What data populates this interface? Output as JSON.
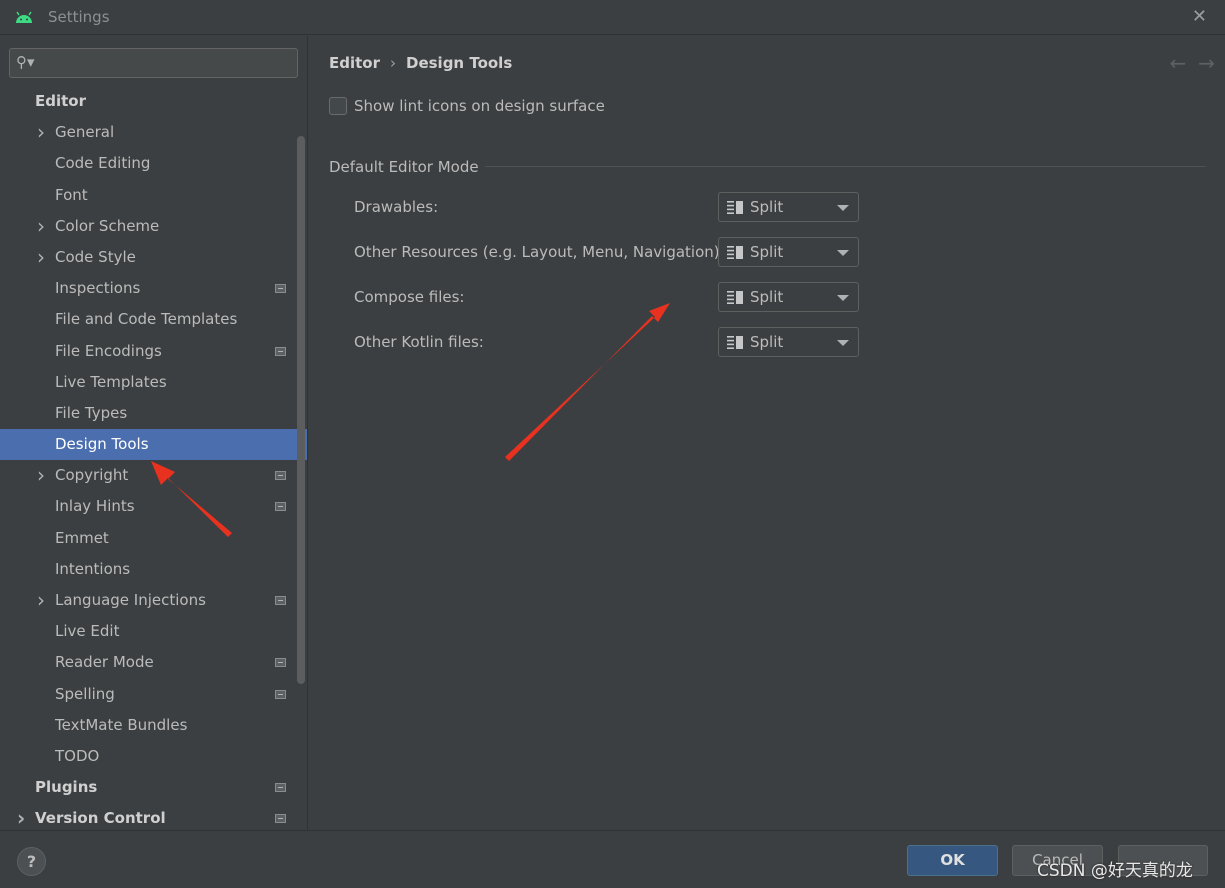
{
  "window": {
    "title": "Settings",
    "close_glyph": "✕"
  },
  "sidebar": {
    "search": {
      "value": "",
      "placeholder": ""
    },
    "items": [
      {
        "label": "Editor",
        "type": "section"
      },
      {
        "label": "General",
        "expandable": true
      },
      {
        "label": "Code Editing"
      },
      {
        "label": "Font"
      },
      {
        "label": "Color Scheme",
        "expandable": true
      },
      {
        "label": "Code Style",
        "expandable": true
      },
      {
        "label": "Inspections",
        "project_icon": true
      },
      {
        "label": "File and Code Templates"
      },
      {
        "label": "File Encodings",
        "project_icon": true
      },
      {
        "label": "Live Templates"
      },
      {
        "label": "File Types"
      },
      {
        "label": "Design Tools",
        "selected": true
      },
      {
        "label": "Copyright",
        "expandable": true,
        "project_icon": true
      },
      {
        "label": "Inlay Hints",
        "project_icon": true
      },
      {
        "label": "Emmet"
      },
      {
        "label": "Intentions"
      },
      {
        "label": "Language Injections",
        "expandable": true,
        "project_icon": true
      },
      {
        "label": "Live Edit"
      },
      {
        "label": "Reader Mode",
        "project_icon": true
      },
      {
        "label": "Spelling",
        "project_icon": true
      },
      {
        "label": "TextMate Bundles"
      },
      {
        "label": "TODO"
      },
      {
        "label": "Plugins",
        "type": "section",
        "project_icon": true
      },
      {
        "label": "Version Control",
        "type": "section",
        "expandable": true,
        "project_icon": true
      }
    ]
  },
  "content": {
    "breadcrumb": {
      "parent": "Editor",
      "separator": "›",
      "current": "Design Tools"
    },
    "nav": {
      "back": "←",
      "forward": "→"
    },
    "lint_checkbox": {
      "label": "Show lint icons on design surface",
      "checked": false
    },
    "group_title": "Default Editor Mode",
    "modes": [
      {
        "label": "Drawables:",
        "value": "Split"
      },
      {
        "label": "Other Resources (e.g. Layout, Menu, Navigation):",
        "value": "Split"
      },
      {
        "label": "Compose files:",
        "value": "Split"
      },
      {
        "label": "Other Kotlin files:",
        "value": "Split"
      }
    ]
  },
  "footer": {
    "help": "?",
    "ok": "OK",
    "cancel": "Cancel",
    "apply": "",
    "watermark": "CSDN @好天真的龙"
  },
  "colors": {
    "background": "#3c3f41",
    "selection": "#4b6eaf",
    "ok_button": "#365880",
    "annotation_arrow": "#e8321f",
    "android_icon": "#3ddc84"
  }
}
